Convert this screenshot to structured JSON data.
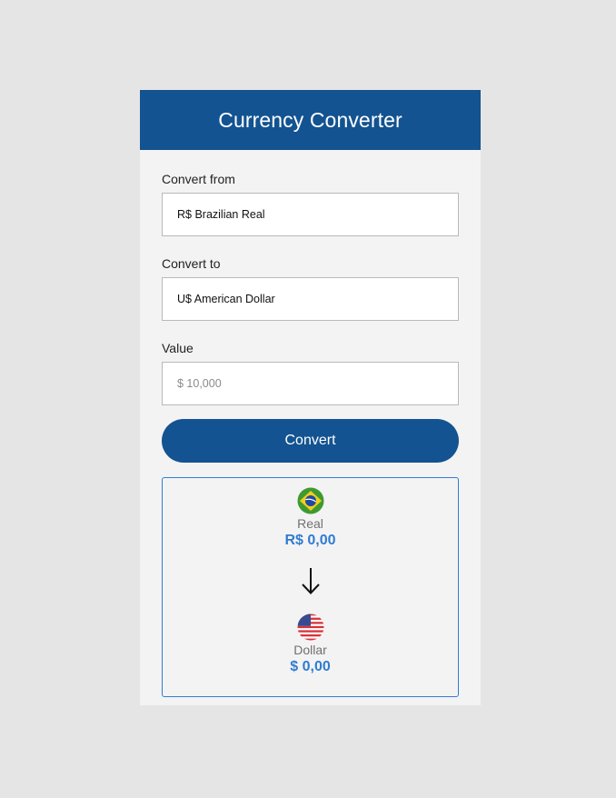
{
  "header": {
    "title": "Currency Converter"
  },
  "form": {
    "from_label": "Convert from",
    "from_value": "R$ Brazilian Real",
    "to_label": "Convert to",
    "to_value": "U$ American Dollar",
    "value_label": "Value",
    "value_placeholder": "$ 10,000",
    "convert_button": "Convert"
  },
  "result": {
    "source": {
      "name": "Real",
      "amount": "R$ 0,00",
      "flag_icon": "brazil-flag-icon"
    },
    "target": {
      "name": "Dollar",
      "amount": "$ 0,00",
      "flag_icon": "usa-flag-icon"
    },
    "arrow_icon": "arrow-down-icon"
  },
  "colors": {
    "primary": "#135391",
    "accent": "#2f7cd1",
    "page_bg": "#e5e5e5",
    "card_bg": "#f3f3f3"
  }
}
